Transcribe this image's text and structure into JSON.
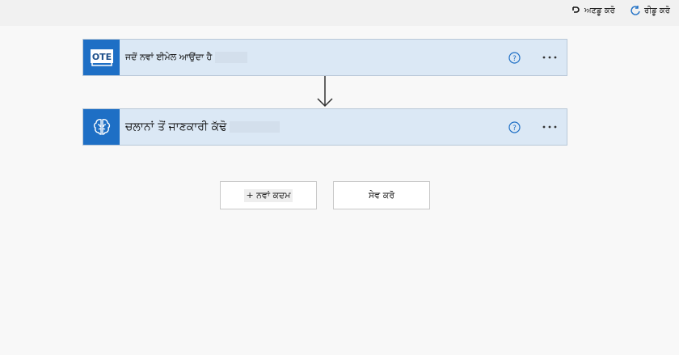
{
  "toolbar": {
    "undo_label": "ਅਣਡੂ ਕਰੋ",
    "redo_label": "ਰੀਡੂ ਕਰੋ"
  },
  "flow": {
    "steps": [
      {
        "app_badge": "OTE",
        "title": "ਜਦੋਂ ਨਵਾਂ ਈਮੇਲ ਆਉਂਦਾ ਹੈ",
        "icon": "outlook-icon"
      },
      {
        "title": "ਚਲਾਨਾਂ ਤੋਂ ਜਾਣਕਾਰੀ ਕੱਢੋ",
        "icon": "ai-brain-icon"
      }
    ]
  },
  "actions": {
    "new_step_label": "+ ਨਵਾਂ ਕਦਮ",
    "save_label": "ਸੇਵ ਕਰੋ"
  },
  "colors": {
    "accent": "#1e6fc5",
    "card_bg": "#dbe8f5",
    "help_icon": "#1e6fc5"
  }
}
